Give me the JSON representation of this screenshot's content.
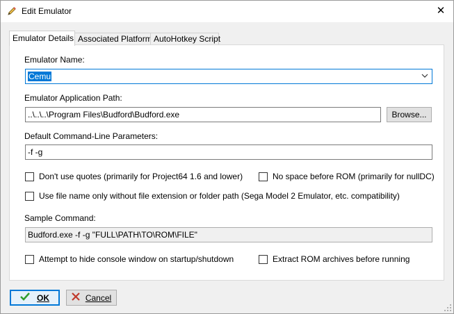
{
  "window": {
    "title": "Edit Emulator",
    "close_glyph": "✕",
    "title_icon": "pencil-icon"
  },
  "tabs": [
    {
      "label": "Emulator Details",
      "active": true
    },
    {
      "label": "Associated Platforms",
      "active": false
    },
    {
      "label": "AutoHotkey Script",
      "active": false
    }
  ],
  "form": {
    "name_label": "Emulator Name:",
    "name_value": "Cemu",
    "path_label": "Emulator Application Path:",
    "path_value": "..\\..\\..\\Program Files\\Budford\\Budford.exe",
    "browse_label": "Browse...",
    "params_label": "Default Command-Line Parameters:",
    "params_value": "-f -g",
    "sample_label": "Sample Command:",
    "sample_value": "Budford.exe -f -g \"FULL\\PATH\\TO\\ROM\\FILE\""
  },
  "options": {
    "no_quotes": {
      "label": "Don't use quotes (primarily for Project64 1.6 and lower)",
      "checked": false
    },
    "no_space": {
      "label": "No space before ROM (primarily for nullDC)",
      "checked": false
    },
    "file_name_only": {
      "label": "Use file name only without file extension or folder path (Sega Model 2 Emulator, etc. compatibility)",
      "checked": false
    },
    "hide_console": {
      "label": "Attempt to hide console window on startup/shutdown",
      "checked": false
    },
    "extract_rom": {
      "label": "Extract ROM archives before running",
      "checked": false
    }
  },
  "buttons": {
    "ok_label": "OK",
    "cancel_label": "Cancel"
  },
  "colors": {
    "accent": "#0078d7",
    "ok_check": "#2e9e2e",
    "cancel_x": "#c0392b"
  }
}
